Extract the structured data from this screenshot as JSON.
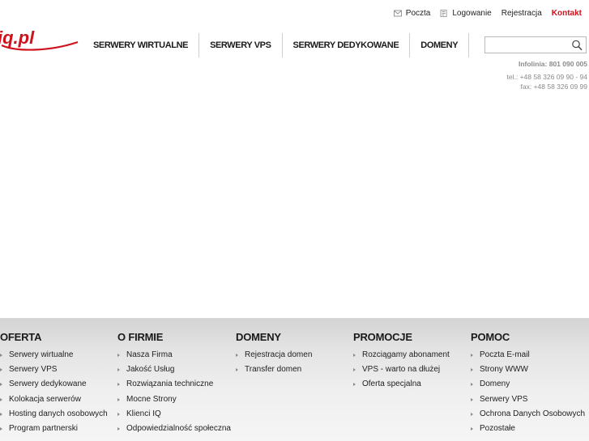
{
  "toplinks": {
    "mail": {
      "label": "Poczta",
      "icon": "envelope-icon"
    },
    "login": {
      "label": "Logowanie",
      "icon": "login-icon"
    },
    "register": {
      "label": "Rejestracja"
    },
    "contact": {
      "label": "Kontakt",
      "color": "#d0111b"
    }
  },
  "logo": {
    "text": "iq.pl",
    "color": "#d0111b"
  },
  "nav": {
    "items": [
      {
        "label": "SERWERY WIRTUALNE"
      },
      {
        "label": "SERWERY VPS"
      },
      {
        "label": "SERWERY DEDYKOWANE"
      },
      {
        "label": "DOMENY"
      }
    ]
  },
  "search": {
    "value": "",
    "placeholder": "",
    "icon": "search-icon"
  },
  "contact": {
    "infolinia": "Infolinia: 801 090 005",
    "tel": "tel.: +48 58 326 09 90 - 94",
    "fax": "fax: +48 58 326 09 99"
  },
  "footer": {
    "columns": [
      {
        "heading": "OFERTA",
        "items": [
          "Serwery wirtualne",
          "Serwery VPS",
          "Serwery dedykowane",
          "Kolokacja serwerów",
          "Hosting danych osobowych",
          "Program partnerski"
        ]
      },
      {
        "heading": "O FIRMIE",
        "items": [
          "Nasza Firma",
          "Jakość Usług",
          "Rozwiązania techniczne",
          "Mocne Strony",
          "Klienci IQ",
          "Odpowiedzialność społeczna"
        ]
      },
      {
        "heading": "DOMENY",
        "items": [
          "Rejestracja domen",
          "Transfer domen"
        ]
      },
      {
        "heading": "PROMOCJE",
        "items": [
          "Rozciągamy abonament",
          "VPS - warto na dłużej",
          "Oferta specjalna"
        ]
      },
      {
        "heading": "POMOC",
        "items": [
          "Poczta E-mail",
          "Strony WWW",
          "Domeny",
          "Serwery VPS",
          "Ochrona Danych Osobowych",
          "Pozostałe"
        ]
      }
    ]
  }
}
